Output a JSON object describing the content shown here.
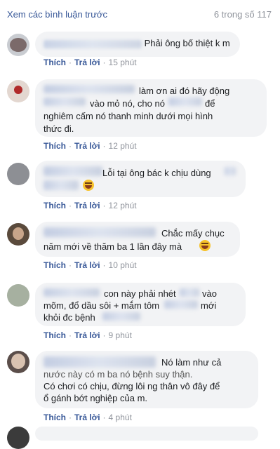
{
  "header": {
    "view_previous": "Xem các bình luận trước",
    "count": "6 trong số 117"
  },
  "comments": [
    {
      "lines": [
        "Phải ông bố thiệt k m"
      ],
      "like": "Thích",
      "reply": "Trả lời",
      "time": "15 phút"
    },
    {
      "lines": [
        "làm ơn ai đó hãy động",
        "vào mỏ nó, cho nó",
        "để",
        "nghiêm cấm nó thanh minh dưới mọi hình",
        "thức đi."
      ],
      "like": "Thích",
      "reply": "Trả lời",
      "time": "12 phút"
    },
    {
      "lines": [
        "Lỗi tại ông bác k chịu dùng"
      ],
      "like": "Thích",
      "reply": "Trả lời",
      "time": "12 phút"
    },
    {
      "lines": [
        "Chắc mấy chục",
        "năm mới về thăm ba 1 lần đây mà"
      ],
      "like": "Thích",
      "reply": "Trả lời",
      "time": "10 phút"
    },
    {
      "lines": [
        "con này phải nhét",
        "vào",
        "mõm, đổ dầu sôi + mắm tôm",
        "mới",
        "khỏi đc bệnh"
      ],
      "like": "Thích",
      "reply": "Trả lời",
      "time": "9 phút"
    },
    {
      "lines": [
        "Nó làm như cả",
        "nước này có m ba nó bệnh suy thận.",
        "Có chơi có chịu, đừng lôi ng thân vô đây để",
        "ổ gánh bớt nghiệp của m."
      ],
      "like": "Thích",
      "reply": "Trả lời",
      "time": "4 phút"
    }
  ],
  "icons": {
    "emoji_laugh": "laughing-emoji",
    "emoji_grin": "grinning-emoji"
  }
}
